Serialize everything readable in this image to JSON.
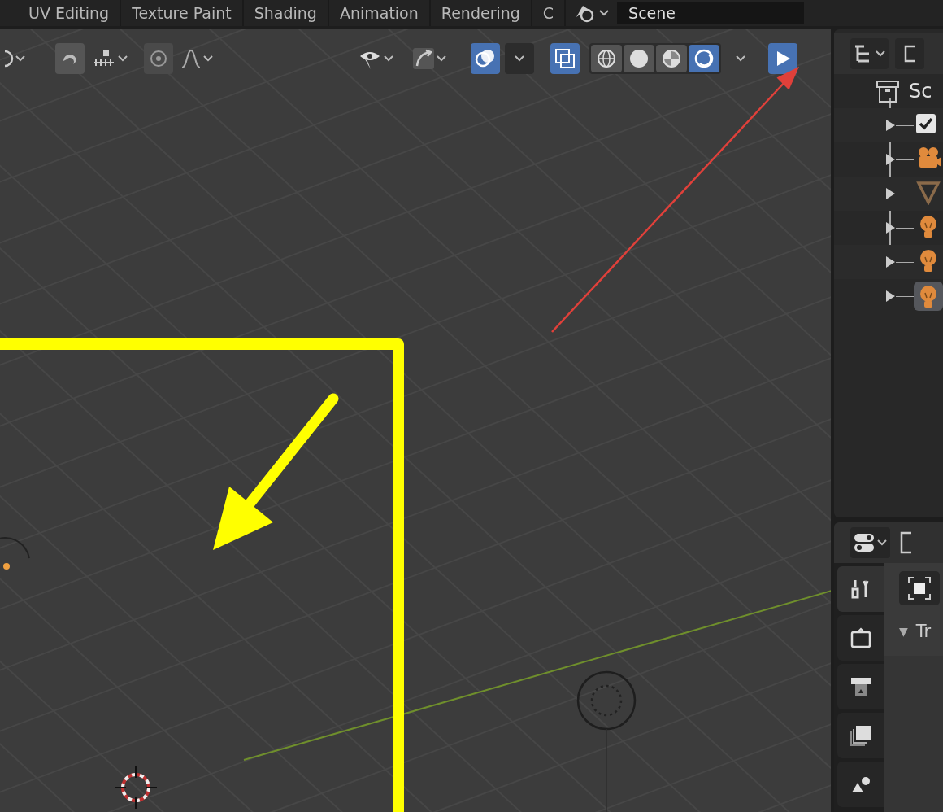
{
  "workspace_tabs": [
    {
      "label": "UV Editing",
      "selected": false
    },
    {
      "label": "Texture Paint",
      "selected": false
    },
    {
      "label": "Shading",
      "selected": false
    },
    {
      "label": "Animation",
      "selected": false
    },
    {
      "label": "Rendering",
      "selected": false
    },
    {
      "label": "C",
      "selected": false
    }
  ],
  "scene": {
    "value": "Scene"
  },
  "viewport_header": {
    "snap": {
      "on": false
    },
    "proportional_edit": {
      "on": false
    },
    "overlays": {
      "on": true
    },
    "xray": {
      "on": true
    },
    "shading_modes": [
      {
        "kind": "wireframe",
        "selected": false
      },
      {
        "kind": "solid",
        "selected": false
      },
      {
        "kind": "material",
        "selected": false
      },
      {
        "kind": "rendered",
        "selected": true
      }
    ]
  },
  "outliner": {
    "root": {
      "label": "Sc",
      "children": [
        {
          "kind": "collection",
          "checked": true,
          "expanded": false,
          "selected": false
        },
        {
          "kind": "camera",
          "expanded": false,
          "selected": false
        },
        {
          "kind": "mesh",
          "expanded": false,
          "selected": false
        },
        {
          "kind": "light",
          "expanded": false,
          "selected": false
        },
        {
          "kind": "light",
          "expanded": false,
          "selected": false
        },
        {
          "kind": "light",
          "expanded": false,
          "selected": true
        }
      ]
    }
  },
  "properties": {
    "tabs": [
      {
        "kind": "tool",
        "selected": true
      },
      {
        "kind": "render",
        "selected": false
      },
      {
        "kind": "output",
        "selected": false
      },
      {
        "kind": "view_layer",
        "selected": false
      },
      {
        "kind": "scene",
        "selected": false
      }
    ],
    "panel": {
      "expander": "▼",
      "title": "Tr",
      "expanded": true
    }
  }
}
